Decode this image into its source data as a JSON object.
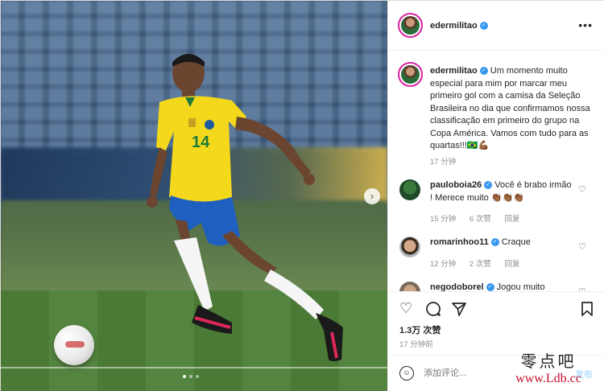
{
  "post": {
    "author": "edermilitao",
    "caption_author": "edermilitao",
    "caption": "Um momento muito especial para mim por marcar meu primeiro gol com a camisa da Seleção Brasileira no dia que confirmamos nossa classificação em primeiro do grupo na Copa América. Vamos com tudo para as quartas!!!🇧🇷💪🏾",
    "caption_time": "17 分钟",
    "likes": "1.3万 次赞",
    "time_ago": "17 分钟前",
    "more_label": "•••",
    "next_label": "›"
  },
  "comments": [
    {
      "user": "pauloboia26",
      "text": "Você é brabo irmão ! Merece muito 👏🏾👏🏾👏🏾",
      "time": "15 分钟",
      "likes": "6 次赞",
      "reply": "回复"
    },
    {
      "user": "romarinhoo11",
      "text": "Craque",
      "time": "12 分钟",
      "likes": "2 次赞",
      "reply": "回复"
    },
    {
      "user": "negodoborel",
      "text": "Jogou muito"
    }
  ],
  "composer": {
    "placeholder": "添加评论...",
    "post_label": "发布"
  },
  "icons": {
    "like": "heart-icon",
    "comment": "comment-icon",
    "share": "share-icon",
    "save": "bookmark-icon",
    "emoji": "emoji-icon"
  },
  "watermark": {
    "text_cn": "零点吧",
    "url": "www.Ldb.cc"
  },
  "colors": {
    "accent": "#3897f0",
    "post_disabled": "#b2dffc",
    "muted": "#8e8e8e",
    "watermark_url": "#c8102e"
  }
}
